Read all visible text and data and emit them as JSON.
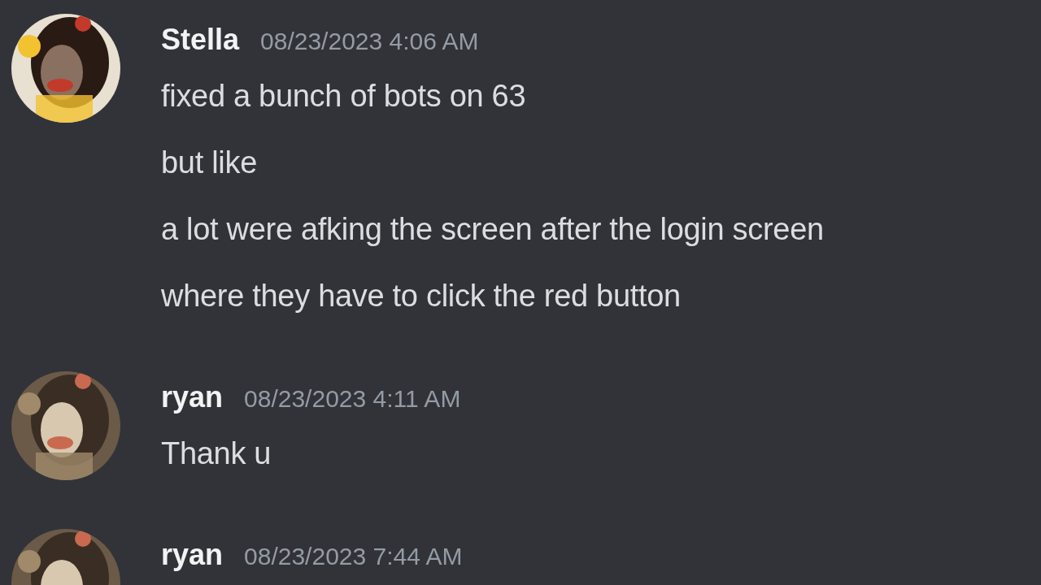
{
  "messages": [
    {
      "author": "Stella",
      "timestamp": "08/23/2023 4:06 AM",
      "lines": [
        "fixed a bunch of bots on 63",
        "but like",
        "a lot were afking the screen after the login screen",
        "where they have to click the red button"
      ]
    },
    {
      "author": "ryan",
      "timestamp": "08/23/2023 4:11 AM",
      "lines": [
        "Thank u"
      ]
    },
    {
      "author": "ryan",
      "timestamp": "08/23/2023 7:44 AM"
    }
  ]
}
